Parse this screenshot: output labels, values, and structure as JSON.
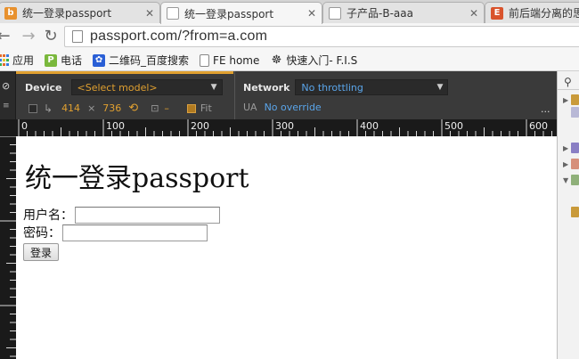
{
  "tabs": [
    {
      "title": "统一登录passport",
      "active": false,
      "favicon_color": "#e8912e"
    },
    {
      "title": "统一登录passport",
      "active": true,
      "favicon_color": "#ffffff"
    },
    {
      "title": "子产品-B-aaa",
      "active": false,
      "favicon_color": "#ffffff"
    },
    {
      "title": "前后端分离的思",
      "active": false,
      "favicon_color": "#d9532c"
    }
  ],
  "toolbar": {
    "back_icon": "back-arrow-icon",
    "forward_icon": "forward-arrow-icon",
    "reload_icon": "reload-icon",
    "url": "passport.com/?from=a.com"
  },
  "bookmarks": [
    {
      "label": "应用",
      "icon": "apps-grid-icon",
      "color": "#e46c2b"
    },
    {
      "label": "电话",
      "icon": "p-logo-icon",
      "glyph": "P",
      "color": "#7ab83c"
    },
    {
      "label": "二维码_百度搜索",
      "icon": "baidu-paw-icon",
      "color": "#2a5fd6"
    },
    {
      "label": "FE home",
      "icon": "page-icon",
      "color": "#ffffff"
    },
    {
      "label": "快速入门- F.I.S",
      "icon": "people-icon",
      "color": "#333333"
    }
  ],
  "emulation": {
    "device_label": "Device",
    "device_select": "<Select model>",
    "width": "414",
    "times": "×",
    "height": "736",
    "dash": "–",
    "fit_label": "Fit",
    "fit_checked": true,
    "network_label": "Network",
    "network_select": "No throttling",
    "ua_label": "UA",
    "ua_value": "No override",
    "more": "..."
  },
  "ruler": {
    "ticks": [
      "0",
      "100",
      "200",
      "300",
      "400",
      "500",
      "600"
    ]
  },
  "page": {
    "heading": "统一登录passport",
    "username_label": "用户名：",
    "password_label": "密码：",
    "username_value": "",
    "password_value": "",
    "login_button": "登录"
  },
  "side_panel": {
    "search_icon": "search-icon"
  }
}
